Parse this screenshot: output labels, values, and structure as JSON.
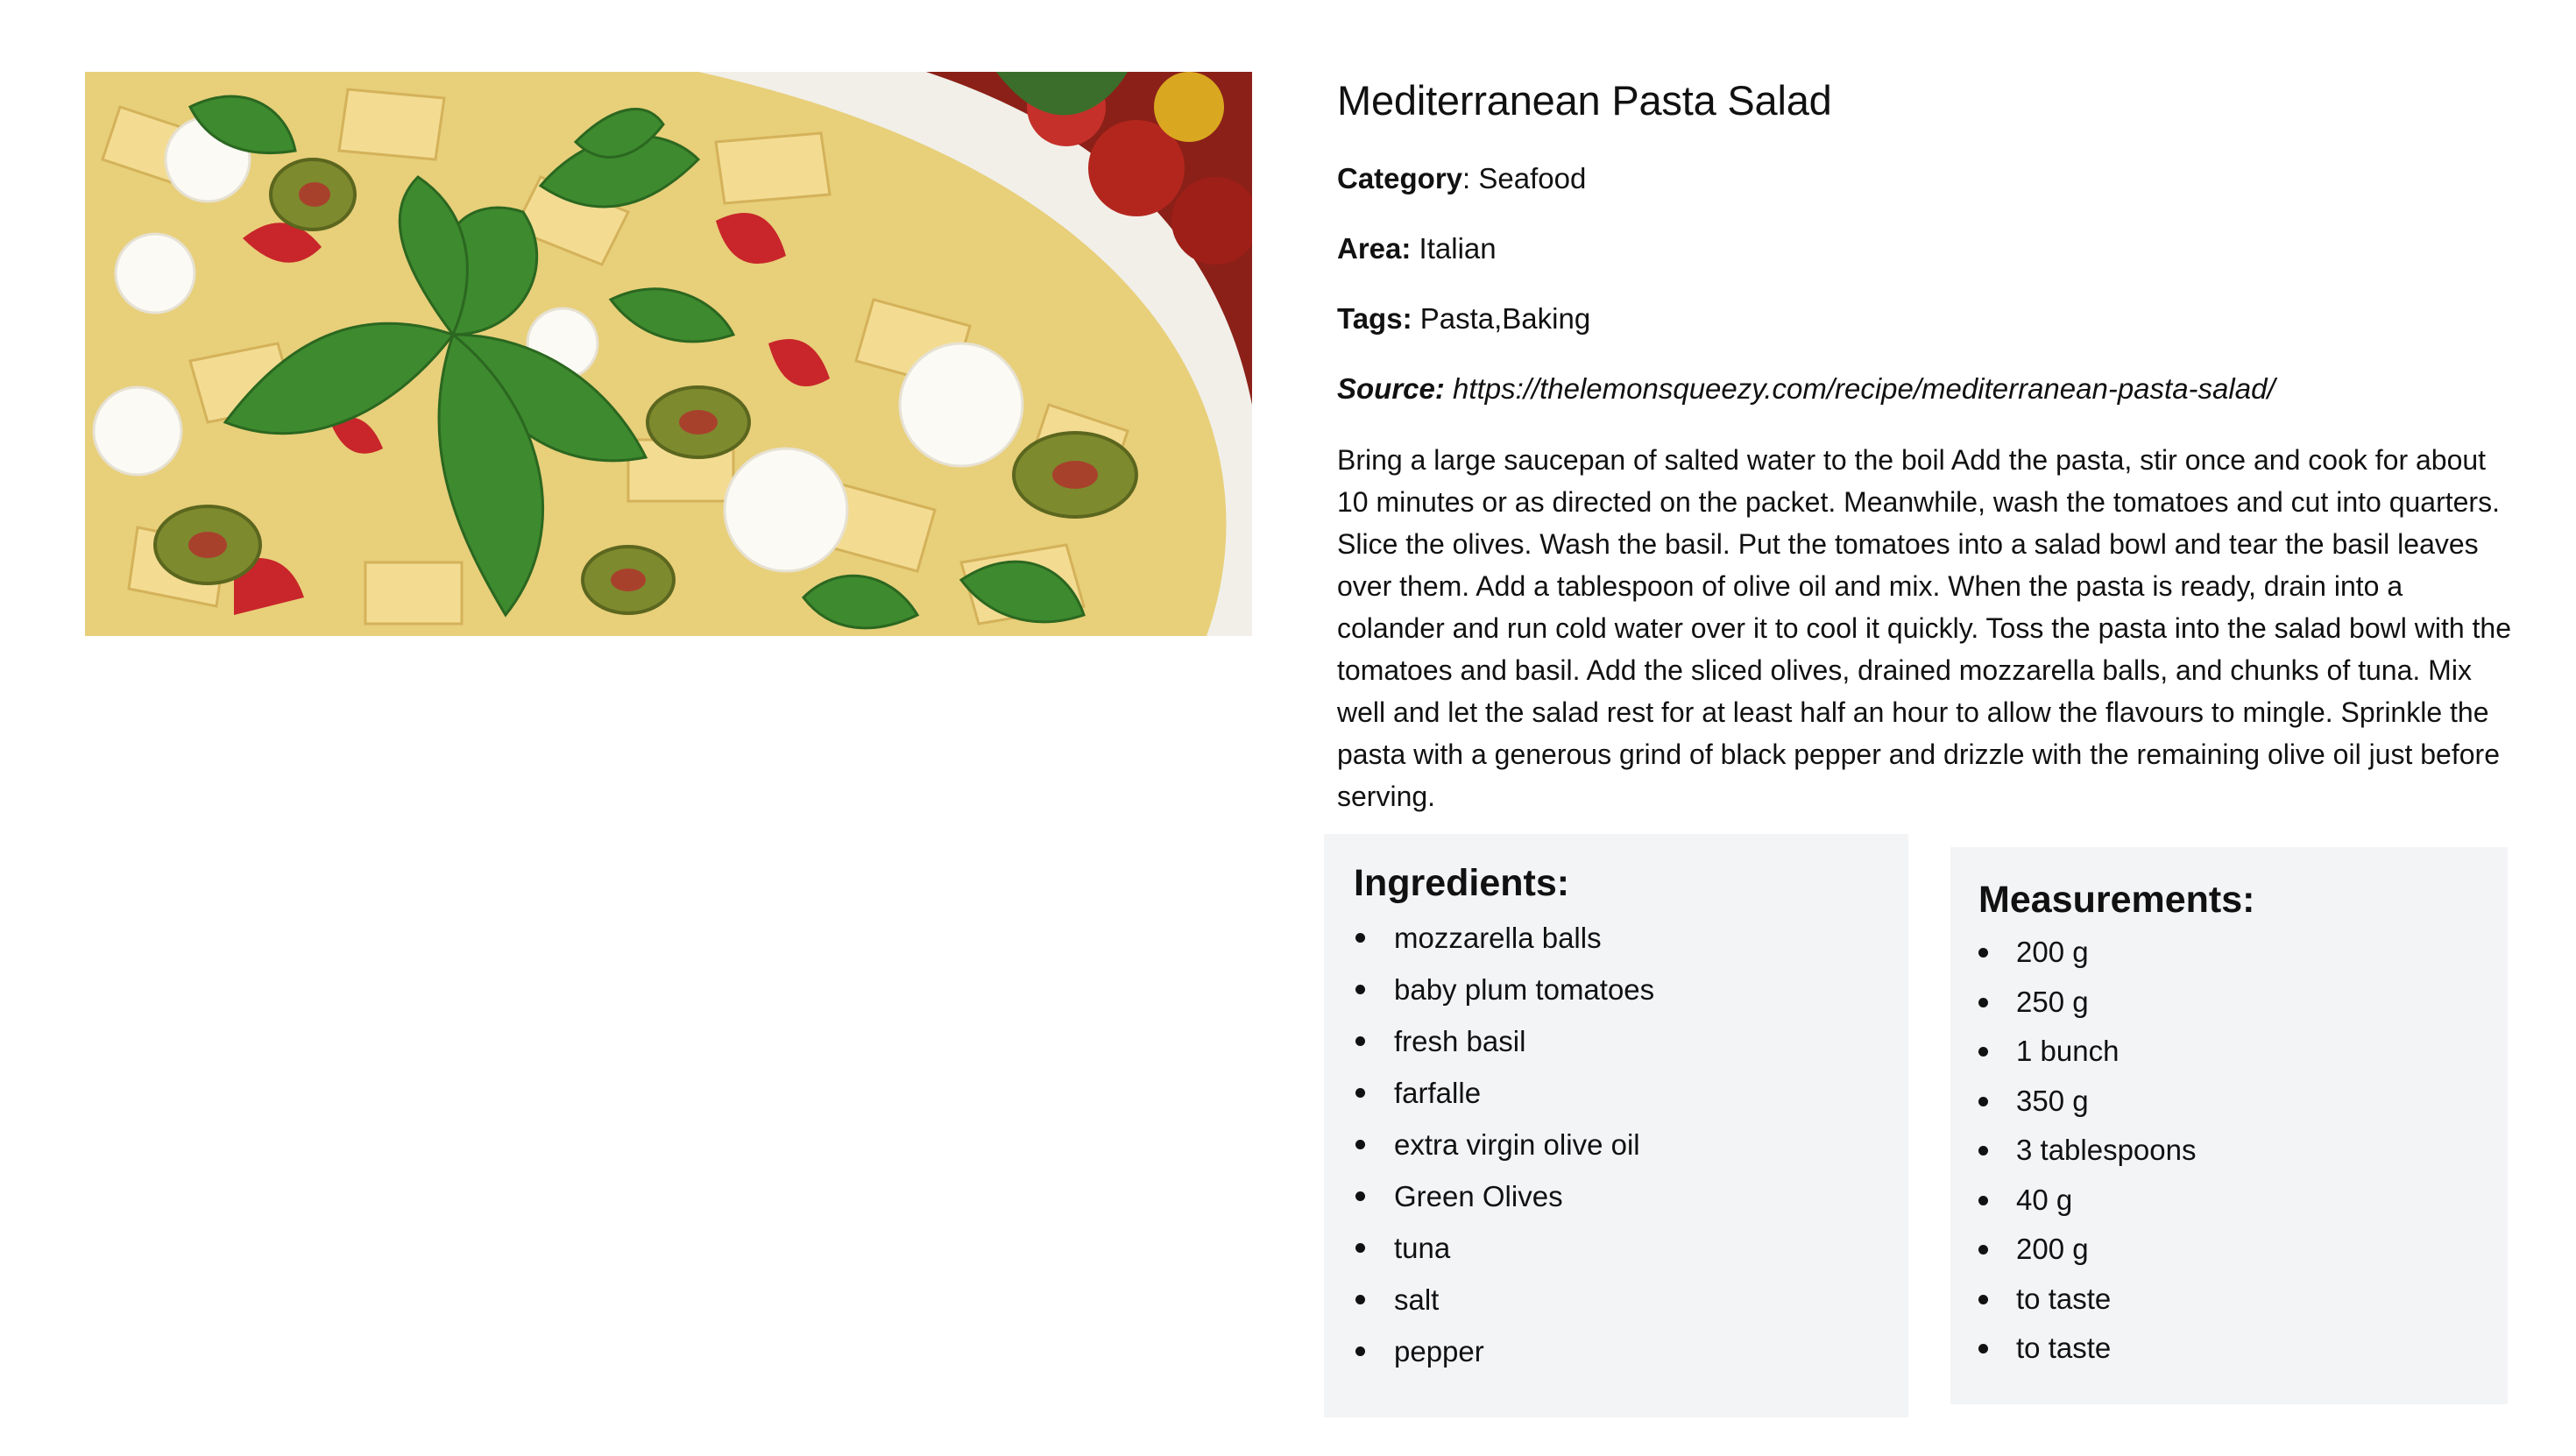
{
  "meal": {
    "title": "Mediterranean Pasta Salad",
    "category_label": "Category",
    "category": "Seafood",
    "area_label": "Area:",
    "area": "Italian",
    "tags_label": "Tags:",
    "tags": "Pasta,Baking",
    "source_label": "Source:",
    "source": "https://thelemonsqueezy.com/recipe/mediterranean-pasta-salad/",
    "instructions": "Bring a large saucepan of salted water to the boil Add the pasta, stir once and cook for about 10 minutes or as directed on the packet. Meanwhile, wash the tomatoes and cut into quarters. Slice the olives. Wash the basil. Put the tomatoes into a salad bowl and tear the basil leaves over them. Add a tablespoon of olive oil and mix. When the pasta is ready, drain into a colander and run cold water over it to cool it quickly. Toss the pasta into the salad bowl with the tomatoes and basil. Add the sliced olives, drained mozzarella balls, and chunks of tuna. Mix well and let the salad rest for at least half an hour to allow the flavours to mingle. Sprinkle the pasta with a generous grind of black pepper and drizzle with the remaining olive oil just before serving."
  },
  "ingredients": {
    "heading": "Ingredients:",
    "items": [
      "mozzarella balls",
      "baby plum tomatoes",
      "fresh basil",
      "farfalle",
      "extra virgin olive oil",
      "Green Olives",
      "tuna",
      "salt",
      "pepper"
    ]
  },
  "measurements": {
    "heading": "Measurements:",
    "items": [
      "200 g",
      "250 g",
      "1 bunch",
      "350 g",
      "3 tablespoons",
      "40 g",
      "200 g",
      "to taste",
      "to taste"
    ]
  }
}
